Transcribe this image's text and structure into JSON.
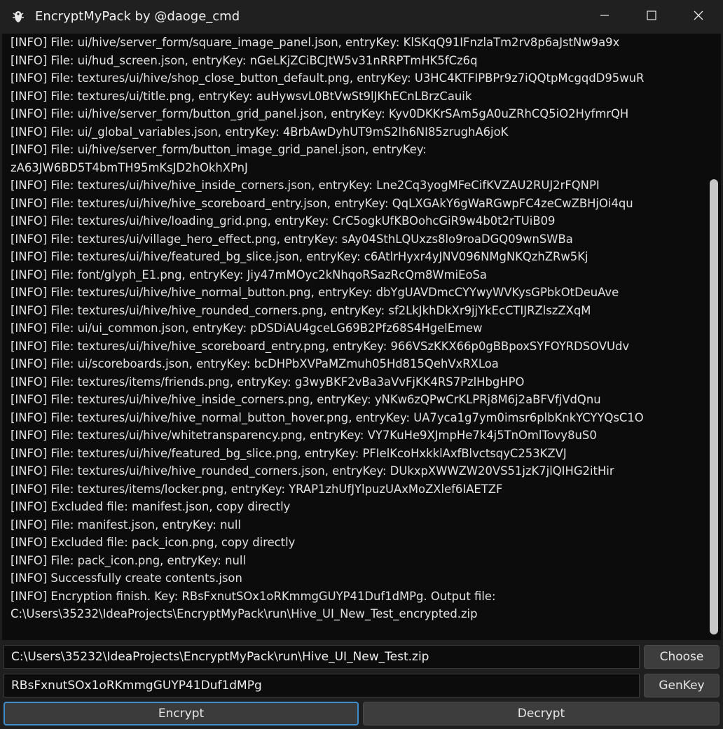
{
  "window": {
    "title": "EncryptMyPack by @daoge_cmd",
    "icons": {
      "app": "pack-icon",
      "minimize": "minimize-icon",
      "maximize": "maximize-icon",
      "close": "close-icon"
    }
  },
  "log": {
    "lines": [
      "[INFO] File: ui/hive/server_form/square_image_panel.json, entryKey: KlSKqQ91IFnzlaTm2rv8p6aJstNw9a9x",
      "[INFO] File: ui/hud_screen.json, entryKey: nGeLKjZCiBCJtW5v31nRRPTmHK5fCz6q",
      "[INFO] File: textures/ui/hive/shop_close_button_default.png, entryKey: U3HC4KTFIPBPr9z7iQQtpMcgqdD95wuR",
      "[INFO] File: textures/ui/title.png, entryKey: auHywsvL0BtVwSt9lJKhECnLBrzCauik",
      "[INFO] File: ui/hive/server_form/button_grid_panel.json, entryKey: Kyv0DKKrSAm5gA0uZRhCQ5iO2HyfmrQH",
      "[INFO] File: ui/_global_variables.json, entryKey: 4BrbAwDyhUT9mS2lh6NI85zrughA6joK",
      "[INFO] File: ui/hive/server_form/button_image_grid_panel.json, entryKey:",
      "zA63JW6BD5T4bmTH95mKsJD2hOkhXPnJ",
      "[INFO] File: textures/ui/hive/hive_inside_corners.json, entryKey: Lne2Cq3yogMFeCifKVZAU2RUJ2rFQNPI",
      "[INFO] File: textures/ui/hive/hive_scoreboard_entry.json, entryKey: QqLXGAkY6gWaRGwpFC4zeCwZBHjOi4qu",
      "[INFO] File: textures/ui/hive/loading_grid.png, entryKey: CrC5ogkUfKBOohcGiR9w4b0t2rTUiB09",
      "[INFO] File: textures/ui/village_hero_effect.png, entryKey: sAy04SthLQUxzs8lo9roaDGQ09wnSWBa",
      "[INFO] File: textures/ui/hive/featured_bg_slice.json, entryKey: c6AtlrHyxr4yJNV096NMgNKQzhZRw5Kj",
      "[INFO] File: font/glyph_E1.png, entryKey: Jiy47mMOyc2kNhqoRSazRcQm8WmiEoSa",
      "[INFO] File: textures/ui/hive/hive_normal_button.png, entryKey: dbYgUAVDmcCYYwyWVKysGPbkOtDeuAve",
      "[INFO] File: textures/ui/hive/hive_rounded_corners.png, entryKey: sf2LkJkhDkXr9jjYkEcCTIJRZlszZXqM",
      "[INFO] File: ui/ui_common.json, entryKey: pDSDiAU4gceLG69B2Pfz68S4HgelEmew",
      "[INFO] File: textures/ui/hive/hive_scoreboard_entry.png, entryKey: 966VSzKKX66p0gBBpoxSYFOYRDSOVUdv",
      "[INFO] File: ui/scoreboards.json, entryKey: bcDHPbXVPaMZmuh05Hd815QehVxRXLoa",
      "[INFO] File: textures/items/friends.png, entryKey: g3wyBKF2vBa3aVvFjKK4RS7PzlHbgHPO",
      "[INFO] File: textures/ui/hive/hive_inside_corners.png, entryKey: yNKw6zQPwCrKLPRj8M6j2aBFVfjVdQnu",
      "[INFO] File: textures/ui/hive/hive_normal_button_hover.png, entryKey: UA7yca1g7ym0imsr6plbKnkYCYYQsC1O",
      "[INFO] File: textures/ui/hive/whitetransparency.png, entryKey: VY7KuHe9XJmpHe7k4j5TnOmlTovy8uS0",
      "[INFO] File: textures/ui/hive/featured_bg_slice.png, entryKey: PFIelKcoHxkklAxfBlvctsqyC253KZVJ",
      "[INFO] File: textures/ui/hive/hive_rounded_corners.json, entryKey: DUkxpXWWZW20VS51jzK7jlQIHG2itHir",
      "[INFO] File: textures/items/locker.png, entryKey: YRAP1zhUfJYlpuzUAxMoZXlef6IAETZF",
      "[INFO] Excluded file: manifest.json, copy directly",
      "[INFO] File: manifest.json, entryKey: null",
      "[INFO] Excluded file: pack_icon.png, copy directly",
      "[INFO] File: pack_icon.png, entryKey: null",
      "[INFO] Successfully create contents.json",
      "[INFO] Encryption finish. Key: RBsFxnutSOx1oRKmmgGUYP41Duf1dMPg. Output file:",
      "C:\\Users\\35232\\IdeaProjects\\EncryptMyPack\\run\\Hive_UI_New_Test_encrypted.zip"
    ]
  },
  "controls": {
    "path_value": "C:\\Users\\35232\\IdeaProjects\\EncryptMyPack\\run\\Hive_UI_New_Test.zip",
    "key_value": "RBsFxnutSOx1oRKmmgGUYP41Duf1dMPg",
    "choose_label": "Choose",
    "genkey_label": "GenKey",
    "encrypt_label": "Encrypt",
    "decrypt_label": "Decrypt"
  },
  "colors": {
    "log_background": "#0c0c0c",
    "window_background": "#202020",
    "focus_accent": "#3f8ecb"
  }
}
